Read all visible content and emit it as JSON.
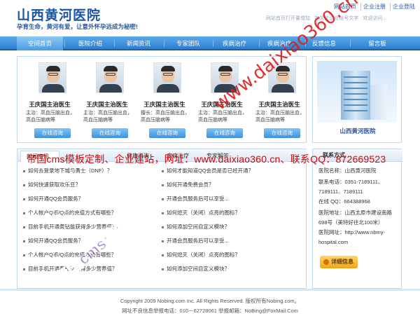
{
  "header": {
    "logo": "山西黄河医院",
    "slogan": "孕育生命，黄河有爱，让意外怀孕远成为秘密!",
    "top_links": [
      "网站首页",
      "企业注册",
      "企业登陆"
    ],
    "marquee": "网站首页打开量增加 · 加关注企业帐号文字 · 欢迎访问..."
  },
  "nav": {
    "items": [
      "空间首页",
      "医院介绍",
      "新闻资讯",
      "专家团队",
      "疾病治疗",
      "疾病治疗",
      "反馈信息",
      "留言板"
    ],
    "active_index": 0
  },
  "doctors": [
    {
      "name": "王庆国主治医生",
      "desc": "主治：高血压脑出血，高血压脑病等",
      "button": "在线咨询"
    },
    {
      "name": "王庆国主治医生",
      "desc": "主治：高血压脑出血，高血压脑病等",
      "button": "在线咨询"
    },
    {
      "name": "王庆国主治医生",
      "desc": "擅长：高血压脑出血，高血压脑病等",
      "button": "在线咨询"
    },
    {
      "name": "王庆国主治医生",
      "desc": "主治：高血压脑出血，高血压脑病等",
      "button": "在线咨询"
    },
    {
      "name": "王庆国主治医生",
      "desc": "主治：高血压脑出血，高血压脑病等",
      "button": "在线咨询"
    }
  ],
  "hospital": {
    "name": "山西黄河医院"
  },
  "news": {
    "tabs": [
      "新闻资讯",
      "健康咨询",
      "疾病治疗",
      "专家解答"
    ],
    "left": [
      "如何去登录地下城与勇士（DNF）？",
      "如何快速获取欢乐豆？",
      "如何开通QQ会员服务？",
      "个人帐户Q币/Q点的充值方式有哪些？",
      "目前手机开通黄钻能获得多少营养值？",
      "如何开通QQ会员服务？",
      "个人帐户Q币/Q点的充值方式有哪些？",
      "目前手机开通黄钻能获得多少营养值？"
    ],
    "right": [
      "如何才能知道QQ会员是否已经开通？",
      "如何开通免费会员？",
      "开通会员服务后可以享受...",
      "如何熄灭（关闭）点亮的图标？",
      "如何添加空间自定义模块？",
      "开通会员服务后可以享受...",
      "如何熄灭（关闭）点亮的图标？",
      "如何添加空间自定义模块？"
    ]
  },
  "contact": {
    "title": "联系方式",
    "lines": [
      "医院名称：山西黄河医院",
      "联系电话：0351-7189111、7189111、7189111",
      "在线 QQ：664388968",
      "医院地址：山西太原市建设南路698号（美特好往北100米）",
      "医院网址：http://www.nbmy-hospital.com"
    ],
    "button": "详细信息"
  },
  "footer": {
    "copyright": "Copyright 2009 Nobing.com Inc. All Rights Reserved. 版权所有Nobing.com。",
    "report": "网址不良信息举报电话：010－62728061 举报邮箱：NoBing@FoxMail.Com"
  },
  "watermark": {
    "banner": "帝国cms模板定制、企业建站，网址：www.daixiao360.cn、联系QQ：872669523",
    "diagonal": "www.daixiao360.cn",
    "diagonal2": "帝国cms模板网"
  }
}
